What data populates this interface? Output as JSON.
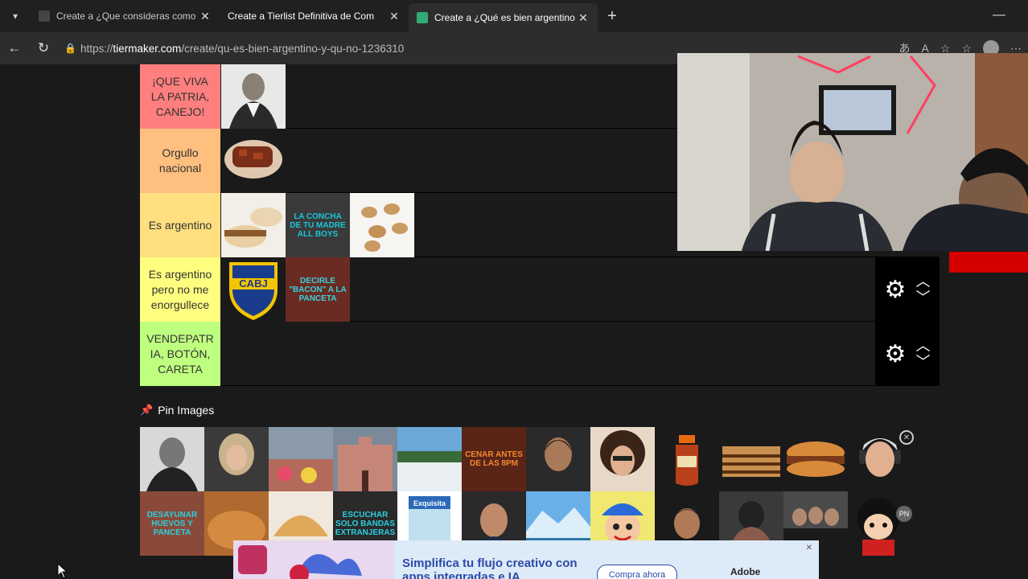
{
  "browser": {
    "tabs": [
      {
        "title": "Create a ¿Que consideras como ir",
        "active": false
      },
      {
        "title": "Create a Tierlist Definitiva de Com",
        "active": false
      },
      {
        "title": "Create a ¿Qué es bien argentino y",
        "active": true
      }
    ],
    "url_prefix": "https://",
    "url_host": "tiermaker.com",
    "url_path": "/create/qu-es-bien-argentino-y-qu-no-1236310"
  },
  "tiers": [
    {
      "label": "¡QUE VIVA\nLA PATRIA,\nCANEJO!",
      "color": "#ff7f7f"
    },
    {
      "label": "Orgullo\nnacional",
      "color": "#ffbf7f"
    },
    {
      "label": "Es argentino",
      "color": "#ffdf7f"
    },
    {
      "label": "Es argentino\npero no me\nenorgullece",
      "color": "#ffff7f"
    },
    {
      "label": "VENDEPATR\nIA, BOTÓN,\nCARETA",
      "color": "#bfff7f"
    }
  ],
  "tier_items": {
    "t3_item2_text": "La concha de tu madre all boys",
    "t4_item1_text": "CABJ",
    "t4_item2_text": "Decirle \"bacon\" a la panceta"
  },
  "pin": {
    "title": "Pin Images",
    "row1_text_tile": "Cenar antes de las 8pm",
    "row2_text1": "Desayunar huevos y panceta",
    "row2_text2": "Escuchar solo bandas extranjeras",
    "row2_brand": "Exquisita",
    "pn_badge": "PN"
  },
  "ad": {
    "headline": "Simplifica tu flujo creativo con apps integradas e IA",
    "button": "Compra ahora",
    "brand": "Adobe"
  }
}
